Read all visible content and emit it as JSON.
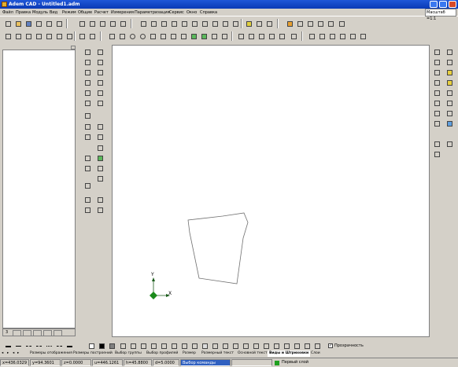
{
  "window": {
    "title": "Adem CAD - Untitled1.adm"
  },
  "menu": [
    "Файл",
    "Правка",
    "Модуль",
    "Вид",
    "Режим",
    "Общие",
    "Расчет",
    "Измерения",
    "Параметризация",
    "Сервис",
    "Окно",
    "Справка"
  ],
  "scale_label": "Масштаб =1:1",
  "canvas": {
    "axis_x": "X",
    "axis_y": "Y"
  },
  "layer_tabs": [
    "Размеры отображения",
    "Размеры построений",
    "Выбор группы",
    "Выбор профилей",
    "Размер",
    "Размерный текст",
    "Основной текст",
    "Виды и Штриховки",
    "Слои"
  ],
  "active_layer_tab": "Виды и Штриховки",
  "transparency_label": "Прозрачность",
  "transparency_checked": true,
  "panel_tab_number": "3",
  "status": {
    "x": "x=436.0329",
    "y": "y=94.3601",
    "z": "z=0.0000",
    "u": "u=446.1261",
    "h": "h=45.8800",
    "d": "d=5.0000",
    "command": "Выбор команды",
    "layer": "Первый слой"
  }
}
